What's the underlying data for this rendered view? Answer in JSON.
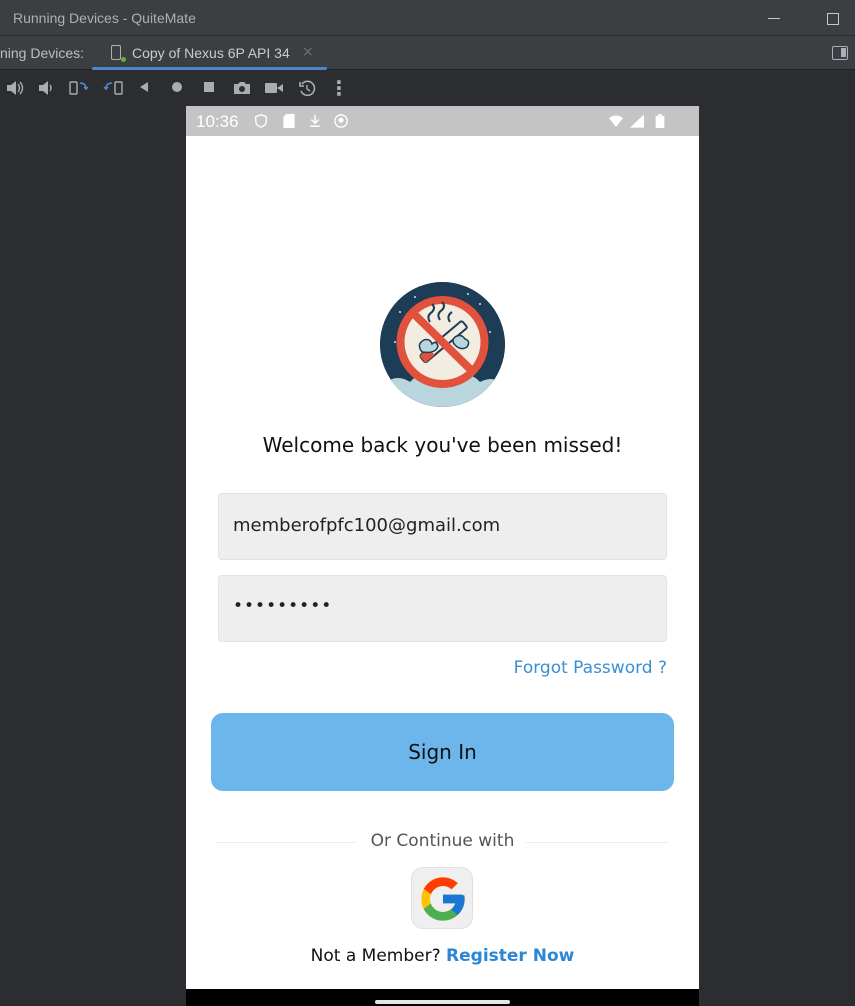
{
  "window": {
    "title": "Running Devices - QuiteMate"
  },
  "tabbar": {
    "prefix": "ning Devices:",
    "tab_label": "Copy of Nexus 6P API 34",
    "close": "×"
  },
  "toolbar": {
    "icons": [
      "volume-up-icon",
      "volume-down-icon",
      "rotate-left-icon",
      "rotate-right-icon",
      "back-icon",
      "home-icon",
      "overview-icon",
      "screenshot-icon",
      "screen-record-icon",
      "snapshot-icon",
      "more-icon"
    ],
    "more": "⋮"
  },
  "device": {
    "status_time": "10:36",
    "welcome": "Welcome back you've been missed!",
    "email_value": "memberofpfc100@gmail.com",
    "password_value": "•••••••••",
    "forgot": "Forgot Password ?",
    "signin": "Sign In",
    "or_continue": "Or Continue with",
    "not_member": "Not a Member?",
    "register": "Register Now"
  },
  "colors": {
    "accent": "#6cb6ec",
    "link": "#2b86d6",
    "tab_underline": "#4a88c7"
  }
}
